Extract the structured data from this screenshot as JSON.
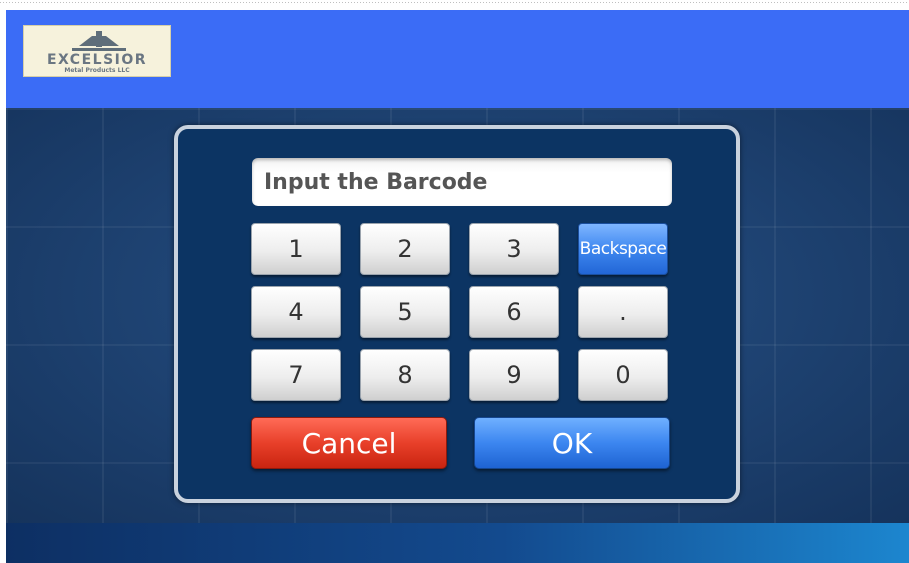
{
  "header": {
    "logo": {
      "name": "EXCELSIOR",
      "subtitle": "Metal Products LLC"
    }
  },
  "barcode": {
    "placeholder": "Input the Barcode",
    "value": ""
  },
  "keypad": {
    "keys": [
      "1",
      "2",
      "3",
      "Backspace",
      "4",
      "5",
      "6",
      ".",
      "7",
      "8",
      "9",
      "0"
    ]
  },
  "actions": {
    "cancel_label": "Cancel",
    "ok_label": "OK"
  },
  "colors": {
    "header": "#3b6cf6",
    "panel": "#0c3463",
    "cancel": "#e8402a",
    "ok": "#3c86f0",
    "backspace": "#3f88f0"
  }
}
